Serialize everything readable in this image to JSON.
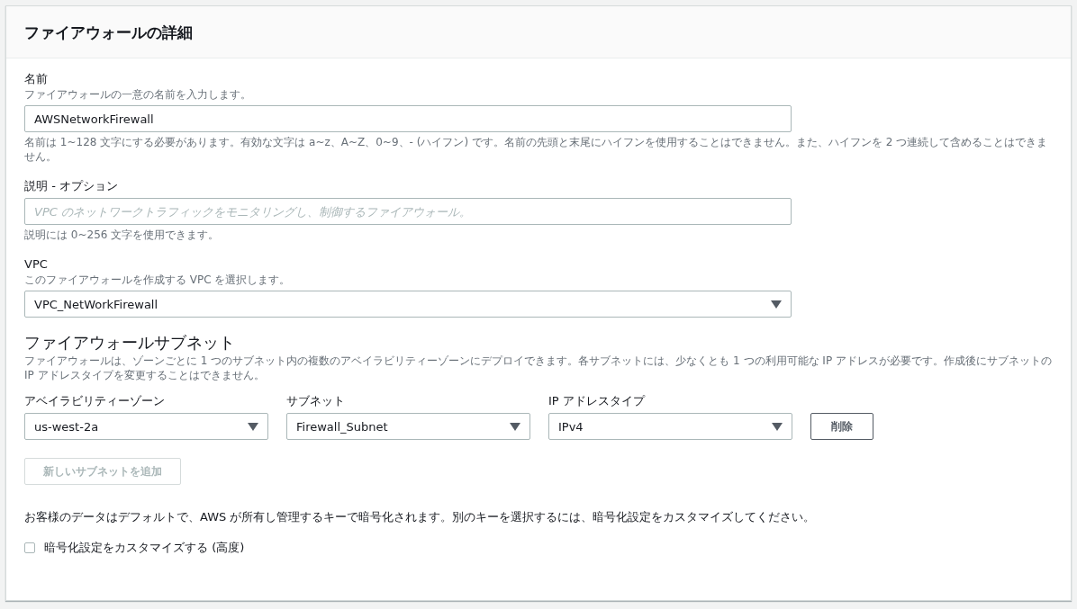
{
  "panel": {
    "title": "ファイアウォールの詳細"
  },
  "name_field": {
    "label": "名前",
    "description": "ファイアウォールの一意の名前を入力します。",
    "value": "AWSNetworkFirewall",
    "constraint": "名前は 1~128 文字にする必要があります。有効な文字は a~z、A~Z、0~9、- (ハイフン) です。名前の先頭と末尾にハイフンを使用することはできません。また、ハイフンを 2 つ連続して含めることはできません。"
  },
  "description_field": {
    "label": "説明 - オプション",
    "placeholder": "VPC のネットワークトラフィックをモニタリングし、制御するファイアウォール。",
    "constraint": "説明には 0~256 文字を使用できます。"
  },
  "vpc_field": {
    "label": "VPC",
    "description": "このファイアウォールを作成する VPC を選択します。",
    "value": "VPC_NetWorkFirewall"
  },
  "subnets": {
    "title": "ファイアウォールサブネット",
    "description": "ファイアウォールは、ゾーンごとに 1 つのサブネット内の複数のアベイラビリティーゾーンにデプロイできます。各サブネットには、少なくとも 1 つの利用可能な IP アドレスが必要です。作成後にサブネットの IP アドレスタイプを変更することはできません。",
    "columns": [
      "アベイラビリティーゾーン",
      "サブネット",
      "IP アドレスタイプ"
    ],
    "rows": [
      {
        "values": [
          "us-west-2a",
          "Firewall_Subnet",
          "IPv4"
        ],
        "remove_button": "削除"
      }
    ],
    "add_button": {
      "label": "新しいサブネットを追加",
      "disabled": true
    }
  },
  "encryption": {
    "note": "お客様のデータはデフォルトで、AWS が所有し管理するキーで暗号化されます。別のキーを選択するには、暗号化設定をカスタマイズしてください。",
    "checkbox": {
      "label": "暗号化設定をカスタマイズする (高度)",
      "checked": false
    }
  }
}
